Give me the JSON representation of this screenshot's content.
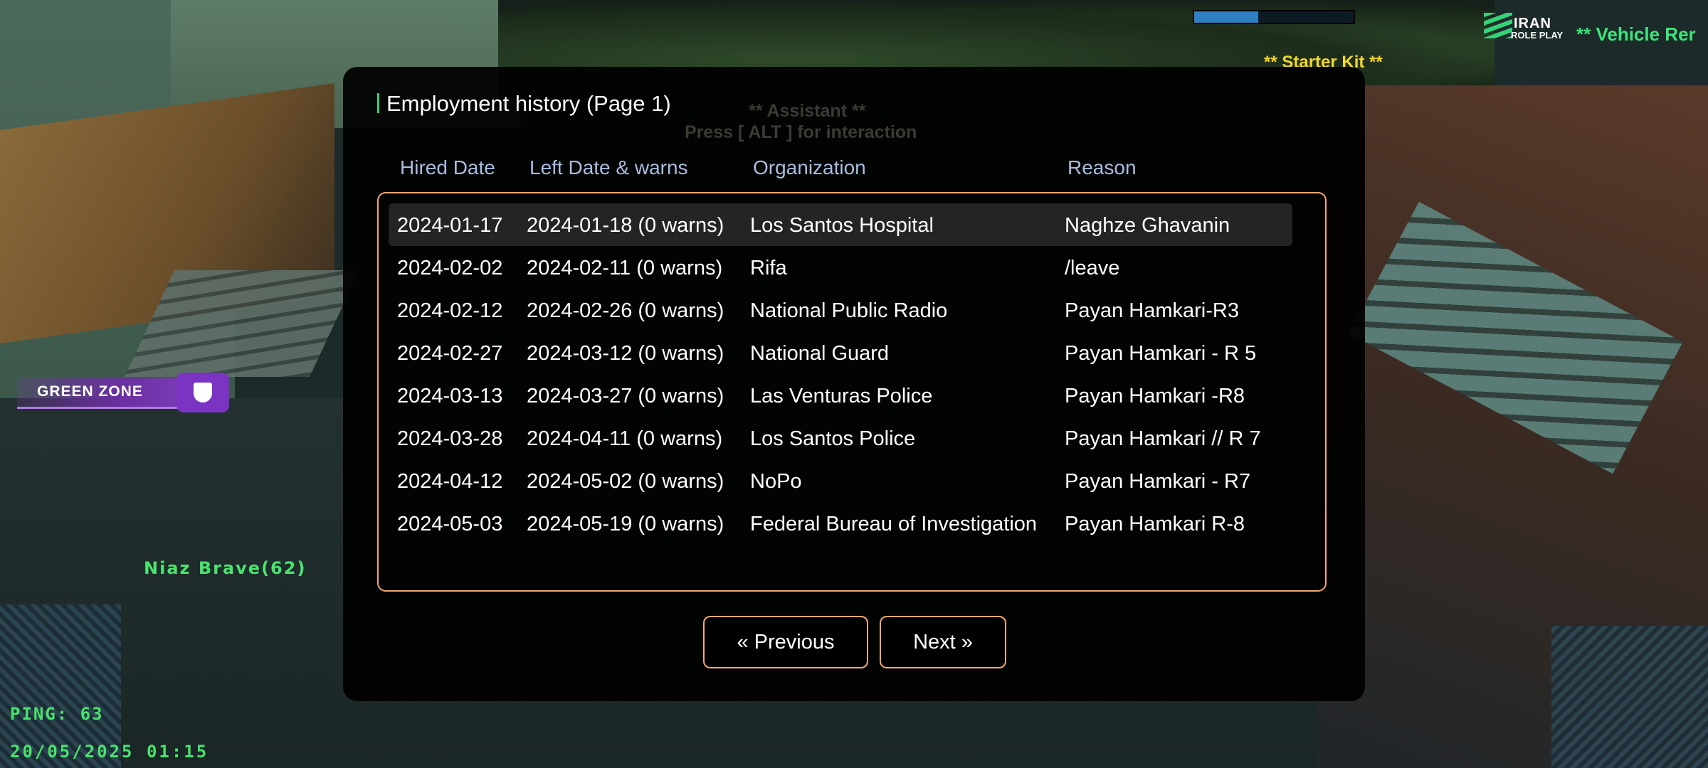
{
  "hud": {
    "vehicle_text": "** Vehicle Rer",
    "starter_kit": "** Starter Kit **",
    "logo_line1": "IRAN",
    "logo_line2": "ROLE PLAY",
    "progress_fraction": 0.4,
    "zone_label": "GREEN ZONE",
    "player_tag": "Niaz Brave(62)",
    "ping": "PING: 63",
    "datetime": "20/05/2025 01:15"
  },
  "ghost": {
    "assistant": "** Assistant **",
    "press": "Press [ ALT ] for interaction"
  },
  "dialog": {
    "title": "Employment history (Page 1)",
    "columns": [
      "Hired Date",
      "Left Date & warns",
      "Organization",
      "Reason"
    ],
    "rows": [
      {
        "hired": "2024-01-17",
        "left": "2024-01-18 (0 warns)",
        "org": "Los Santos Hospital",
        "reason": "Naghze Ghavanin"
      },
      {
        "hired": "2024-02-02",
        "left": "2024-02-11 (0 warns)",
        "org": "Rifa",
        "reason": "/leave"
      },
      {
        "hired": "2024-02-12",
        "left": "2024-02-26 (0 warns)",
        "org": "National Public Radio",
        "reason": "Payan Hamkari-R3"
      },
      {
        "hired": "2024-02-27",
        "left": "2024-03-12 (0 warns)",
        "org": "National Guard",
        "reason": "Payan Hamkari - R 5"
      },
      {
        "hired": "2024-03-13",
        "left": "2024-03-27 (0 warns)",
        "org": "Las Venturas Police",
        "reason": "Payan Hamkari -R8"
      },
      {
        "hired": "2024-03-28",
        "left": "2024-04-11 (0 warns)",
        "org": "Los Santos Police",
        "reason": "Payan Hamkari // R 7"
      },
      {
        "hired": "2024-04-12",
        "left": "2024-05-02 (0 warns)",
        "org": "NoPo",
        "reason": "Payan Hamkari - R7"
      },
      {
        "hired": "2024-05-03",
        "left": "2024-05-19 (0 warns)",
        "org": "Federal Bureau of Investigation",
        "reason": "Payan Hamkari R-8"
      }
    ],
    "prev_label": "« Previous",
    "next_label": "Next »"
  }
}
